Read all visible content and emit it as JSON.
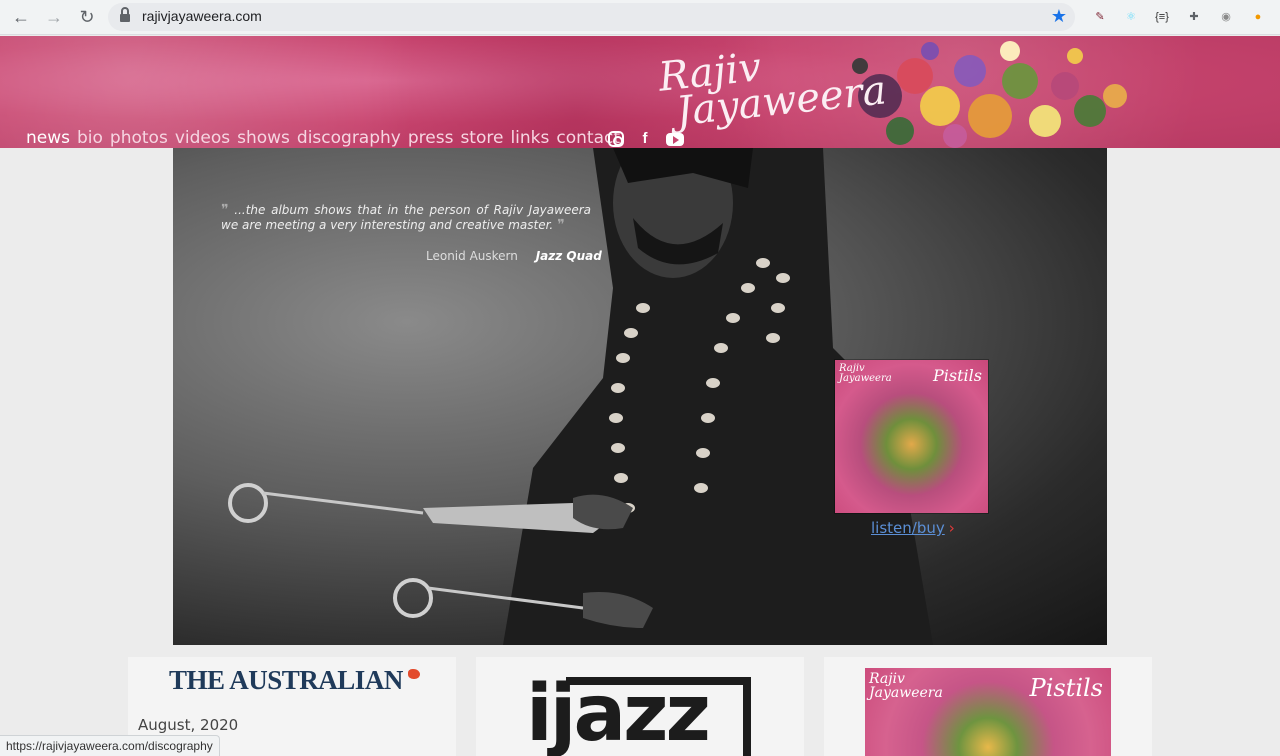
{
  "browser": {
    "url": "rajivjayaweera.com",
    "status_url": "https://rajivjayaweera.com/discography",
    "back_icon": "←",
    "forward_icon": "→",
    "reload_icon": "↻",
    "star_icon": "★",
    "extensions": [
      {
        "name": "eyedropper-extension-icon",
        "glyph": "✎",
        "color": "#7a1e2e"
      },
      {
        "name": "react-devtools-icon",
        "glyph": "⚛",
        "color": "#61dafb"
      },
      {
        "name": "json-viewer-icon",
        "glyph": "{≡}",
        "color": "#333333"
      },
      {
        "name": "extensions-puzzle-icon",
        "glyph": "✚",
        "color": "#5f6368"
      },
      {
        "name": "profile-avatar-icon",
        "glyph": "◉",
        "color": "#8a8a8a"
      },
      {
        "name": "update-indicator-icon",
        "glyph": "●",
        "color": "#f29900"
      }
    ]
  },
  "site": {
    "logo_line1": "Rajiv",
    "logo_line2": "Jayaweera",
    "nav": [
      "news",
      "bio",
      "photos",
      "videos",
      "shows",
      "discography",
      "press",
      "store",
      "links",
      "contact"
    ],
    "active_nav": "news",
    "social": [
      "instagram-icon",
      "facebook-icon",
      "youtube-icon"
    ]
  },
  "hero": {
    "quote": "...the album shows that in the person of Rajiv Jayaweera we are meeting a very interesting and creative master.",
    "quote_open": "❞",
    "quote_close": "❞",
    "author": "Leonid Auskern",
    "source": "Jazz Quad",
    "album_artist_line1": "Rajiv",
    "album_artist_line2": "Jayaweera",
    "album_title": "Pistils",
    "listen_label": "listen/buy",
    "listen_chevron": "›"
  },
  "cards": {
    "card1_logo": "THE AUSTRALIAN",
    "card1_date": "August, 2020",
    "card2_logo": "ijazz",
    "card3_artist_line1": "Rajiv",
    "card3_artist_line2": "Jayaweera",
    "card3_title": "Pistils"
  },
  "colors": {
    "header_pink": "#c8456f",
    "link_blue": "#5b8fd6",
    "chevron_red": "#e23a3a",
    "australian_blue": "#1f3a5a"
  }
}
